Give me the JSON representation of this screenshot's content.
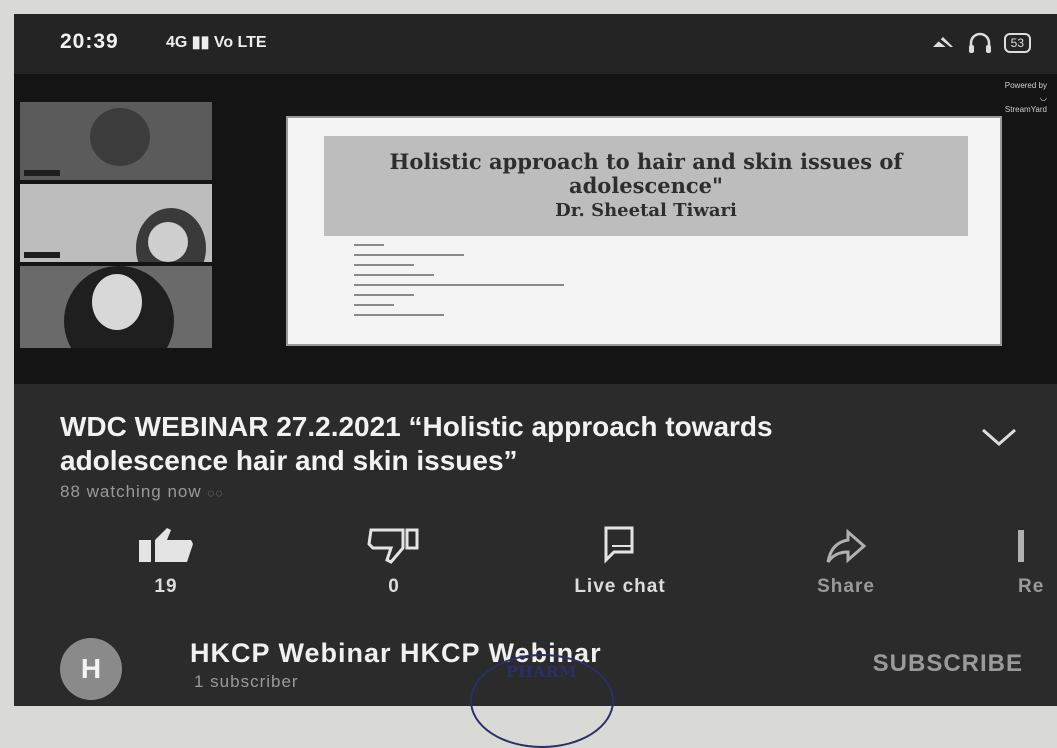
{
  "status_bar": {
    "time": "20:39",
    "signal": "4G ▮▮ Vo LTE",
    "battery": "53"
  },
  "video": {
    "slide_title": "Holistic approach to hair and skin issues of adolescence\"",
    "slide_presenter": "Dr. Sheetal Tiwari"
  },
  "video_info": {
    "title": "WDC WEBINAR 27.2.2021 “Holistic approach towards adolescence hair and skin issues”",
    "watching": "88 watching now"
  },
  "actions": {
    "like_count": "19",
    "dislike_count": "0",
    "live_chat": "Live chat",
    "share": "Share",
    "report_partial": "Re"
  },
  "channel": {
    "avatar_letter": "H",
    "name": "HKCP Webinar HKCP Webinar",
    "subscribers": "1 subscriber",
    "subscribe_label": "SUBSCRIBE"
  },
  "stamp": {
    "text": "PHARM"
  }
}
